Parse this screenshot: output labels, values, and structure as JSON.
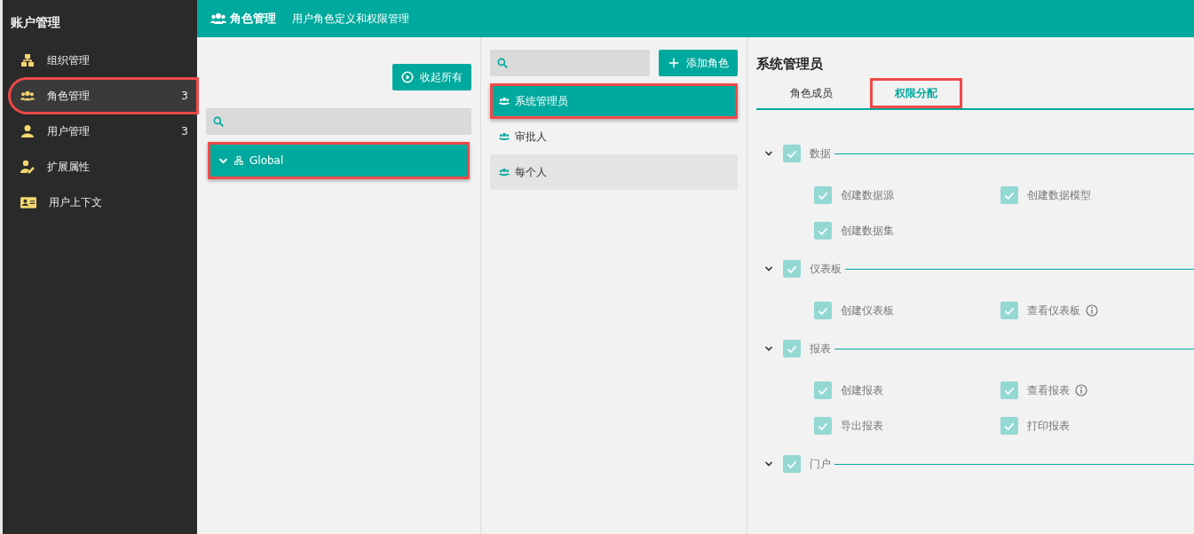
{
  "sidebar": {
    "title": "账户管理",
    "items": [
      {
        "label": "组织管理",
        "selected": false,
        "highlighted": false
      },
      {
        "label": "角色管理",
        "count": "3",
        "selected": true,
        "highlighted": true
      },
      {
        "label": "用户管理",
        "count": "3",
        "selected": false,
        "highlighted": false
      },
      {
        "label": "扩展属性",
        "selected": false,
        "highlighted": false
      },
      {
        "label": "用户上下文",
        "selected": false,
        "highlighted": false
      }
    ]
  },
  "header": {
    "title": "角色管理",
    "subtitle": "用户角色定义和权限管理"
  },
  "org_panel": {
    "collapse_button": "收起所有",
    "tree": [
      {
        "label": "Global",
        "expanded": true,
        "selected": true,
        "highlighted": true
      }
    ]
  },
  "role_panel": {
    "add_button": "添加角色",
    "roles": [
      {
        "label": "系统管理员",
        "selected": true,
        "highlighted": true,
        "hovered": false
      },
      {
        "label": "审批人",
        "selected": false,
        "highlighted": false,
        "hovered": false
      },
      {
        "label": "每个人",
        "selected": false,
        "highlighted": false,
        "hovered": true
      }
    ]
  },
  "detail": {
    "title": "系统管理员",
    "tabs": [
      {
        "label": "角色成员",
        "selected": false,
        "highlighted": false
      },
      {
        "label": "权限分配",
        "selected": true,
        "highlighted": true
      }
    ],
    "sections": [
      {
        "label": "数据",
        "expanded": true,
        "checked": true,
        "items": [
          {
            "label": "创建数据源",
            "checked": true,
            "info": false
          },
          {
            "label": "创建数据模型",
            "checked": true,
            "info": false
          },
          {
            "label": "创建数据集",
            "checked": true,
            "info": false
          }
        ]
      },
      {
        "label": "仪表板",
        "expanded": true,
        "checked": true,
        "items": [
          {
            "label": "创建仪表板",
            "checked": true,
            "info": false
          },
          {
            "label": "查看仪表板",
            "checked": true,
            "info": true
          }
        ]
      },
      {
        "label": "报表",
        "expanded": true,
        "checked": true,
        "items": [
          {
            "label": "创建报表",
            "checked": true,
            "info": false
          },
          {
            "label": "查看报表",
            "checked": true,
            "info": true
          },
          {
            "label": "导出报表",
            "checked": true,
            "info": false
          },
          {
            "label": "打印报表",
            "checked": true,
            "info": false
          }
        ]
      },
      {
        "label": "门户",
        "expanded": true,
        "checked": true
      }
    ]
  }
}
